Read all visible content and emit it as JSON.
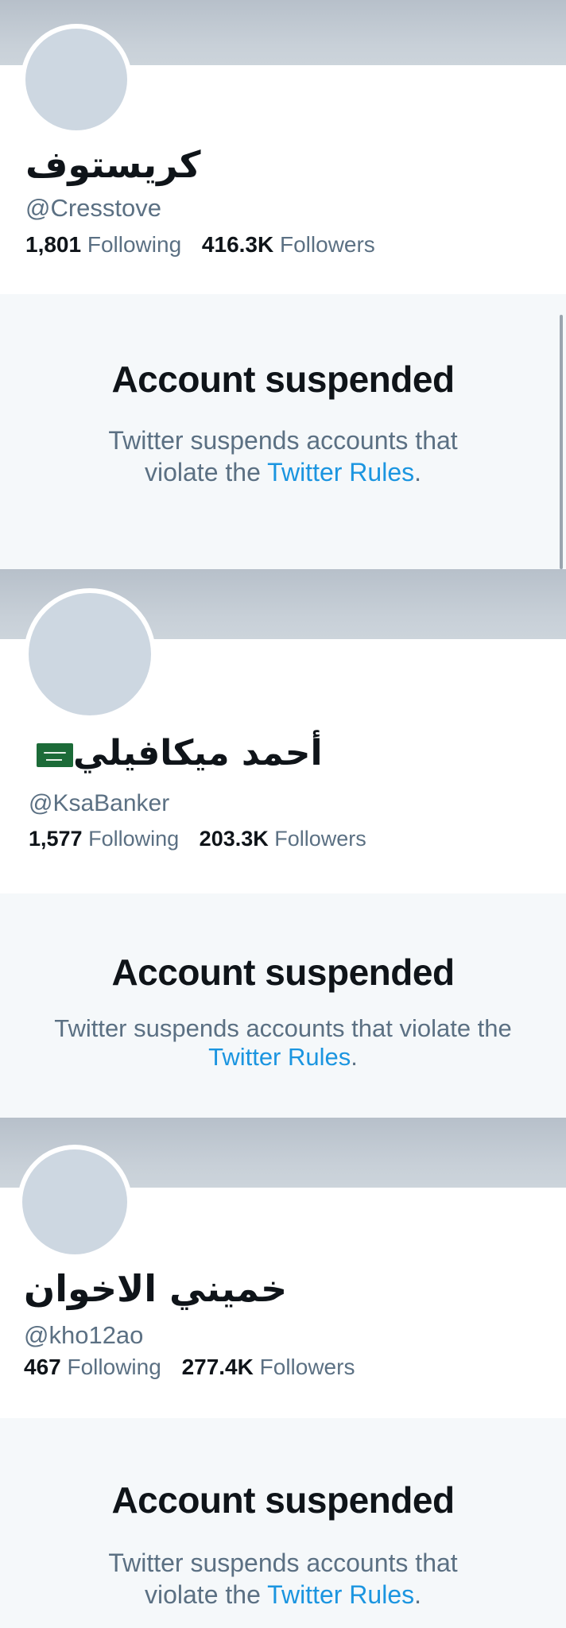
{
  "profiles": [
    {
      "display_name": "كريستوف",
      "handle": "@Cresstove",
      "following_count": "1,801",
      "following_label": "Following",
      "followers_count": "416.3K",
      "followers_label": "Followers",
      "has_flag": false
    },
    {
      "display_name": "أحمد ميكافيلي",
      "handle": "@KsaBanker",
      "following_count": "1,577",
      "following_label": "Following",
      "followers_count": "203.3K",
      "followers_label": "Followers",
      "has_flag": true,
      "flag_icon": "saudi-flag-icon"
    },
    {
      "display_name": "خميني الاخوان",
      "handle": "@kho12ao",
      "following_count": "467",
      "following_label": "Following",
      "followers_count": "277.4K",
      "followers_label": "Followers",
      "has_flag": false
    }
  ],
  "suspension": [
    {
      "title": "Account suspended",
      "message": "Twitter suspends accounts that violate the",
      "link": "Twitter Rules",
      "period": "."
    },
    {
      "title": "Account suspended",
      "message": "Twitter suspends accounts that violate the",
      "link": "Twitter Rules",
      "period": "."
    },
    {
      "title": "Account suspended",
      "message": "Twitter suspends accounts that violate the",
      "link": "Twitter Rules",
      "period": "."
    }
  ],
  "colors": {
    "link": "#1b95e0",
    "banner": "#c3ccd5",
    "avatar": "#cdd7e1",
    "suspended_bg": "#f5f8fa",
    "secondary_text": "#5b7083"
  }
}
